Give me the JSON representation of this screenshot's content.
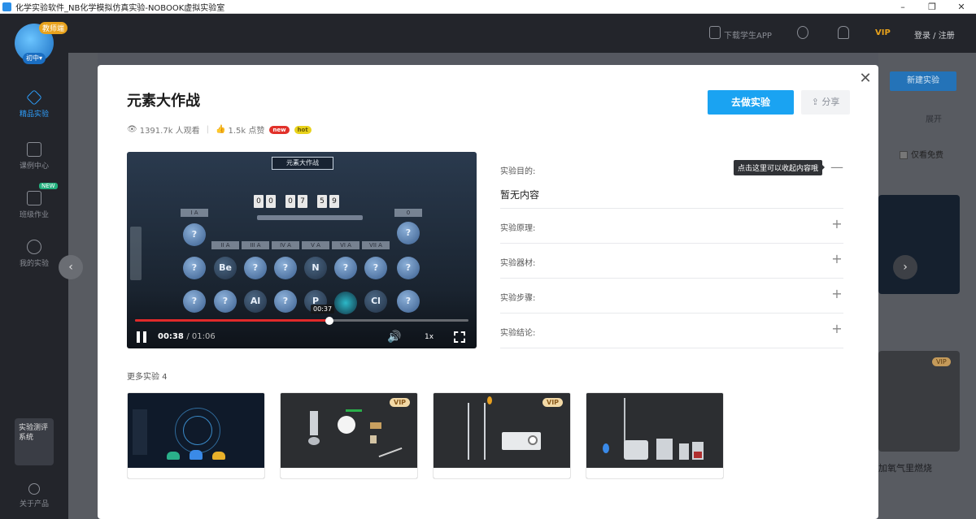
{
  "window": {
    "title": "化学实验软件_NB化学模拟仿真实验-NOBOOK虚拟实验室",
    "minimize": "–",
    "maximize": "❐",
    "close": "✕"
  },
  "sidebar": {
    "badge": "教师端",
    "level": "初中▾",
    "items": [
      {
        "label": "精品实验",
        "active": true
      },
      {
        "label": "课例中心"
      },
      {
        "label": "班级作业",
        "badge": "NEW"
      },
      {
        "label": "我的实验"
      }
    ],
    "eval_label": "实验测评系统",
    "about_label": "关于产品"
  },
  "header": {
    "download_app": "下载学生APP",
    "vip": "VIP",
    "login": "登录 / 注册"
  },
  "background": {
    "new_experiment": "新建实验",
    "expand": "展开",
    "free_only": "仅看免费",
    "vip_tag": "VIP",
    "card_text": "加氧气里燃烧"
  },
  "modal": {
    "title": "元素大作战",
    "views": "1391.7k 人观看",
    "likes": "1.5k 点赞",
    "tag_new": "new",
    "tag_hot": "hot",
    "do_button": "去做实验",
    "share_button": "分享",
    "close": "✕",
    "video": {
      "title": "元素大作战",
      "timer": [
        "0",
        "0",
        "0",
        "7",
        "5",
        "9"
      ],
      "groups": [
        "I A",
        "II A",
        "III A",
        "IV A",
        "V A",
        "VI A",
        "VII A",
        "0"
      ],
      "elements": [
        "Be",
        "N",
        "Al",
        "P",
        "Cl"
      ],
      "hover_time": "00:37",
      "current_time": "00:38",
      "duration": "01:06",
      "progress": 0.584,
      "rate": "1x"
    },
    "accordion": [
      {
        "label": "实验目的:",
        "open": true,
        "content": "暂无内容",
        "tooltip": "点击这里可以收起内容哦"
      },
      {
        "label": "实验原理:"
      },
      {
        "label": "实验器材:"
      },
      {
        "label": "实验步骤:"
      },
      {
        "label": "实验结论:"
      }
    ],
    "more_title": "更多实验 4",
    "more_cards": [
      {
        "vip": false
      },
      {
        "vip": true,
        "vip_label": "VIP"
      },
      {
        "vip": true,
        "vip_label": "VIP"
      },
      {
        "vip": false
      }
    ]
  }
}
